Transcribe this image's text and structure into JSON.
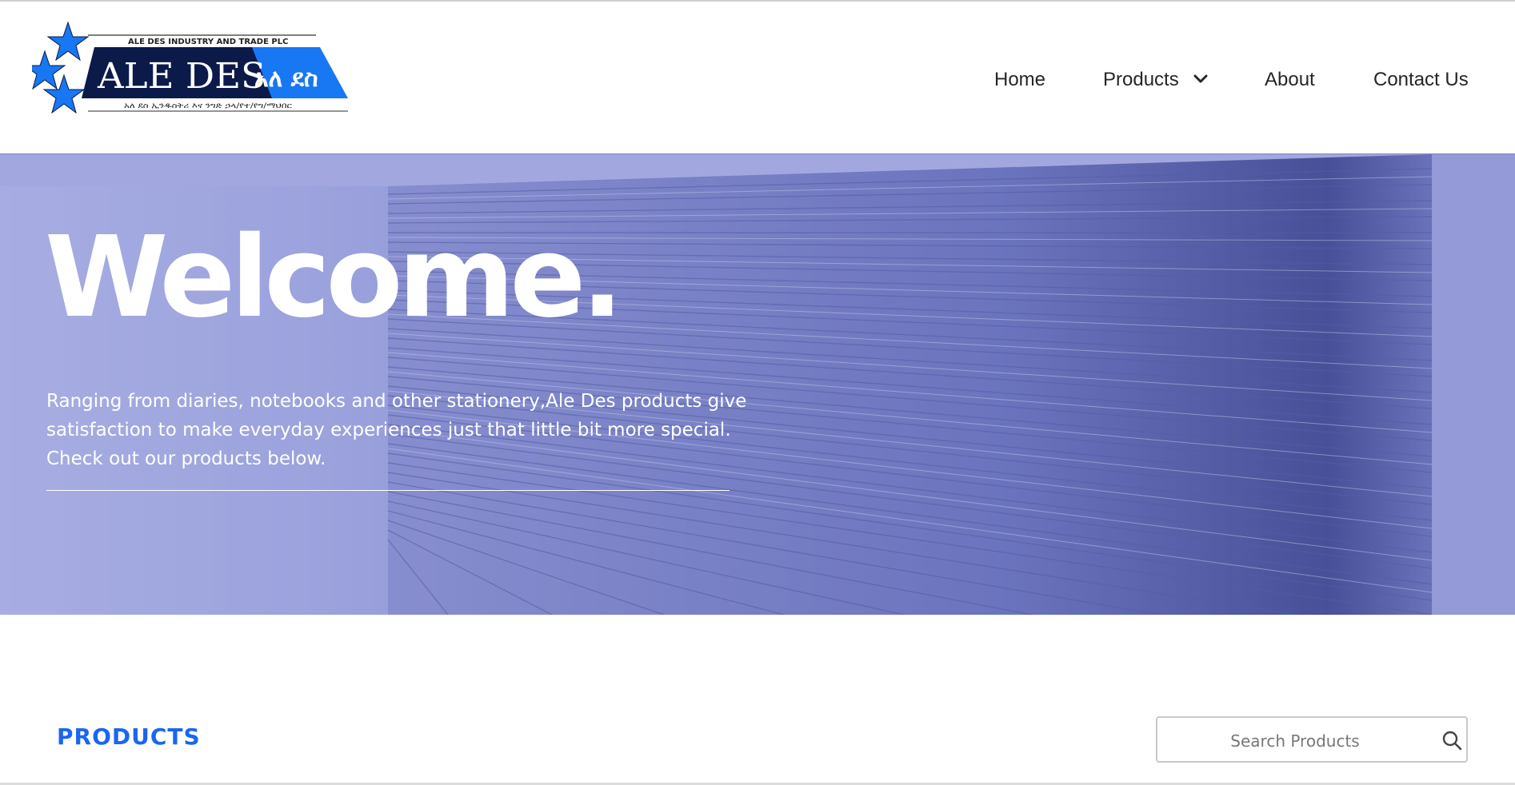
{
  "logo": {
    "company_line": "ALE DES INDUSTRY AND TRADE PLC",
    "brand_latin": "ALE DES",
    "brand_amharic": "አለ ደስ",
    "amharic_subline": "አለ ደስ ኢንዱስትሪ እና ንግድ ኃላ/የተ/የግ/ማህበር"
  },
  "nav": {
    "home": "Home",
    "products": "Products",
    "about": "About",
    "contact": "Contact Us"
  },
  "hero": {
    "title": "Welcome.",
    "text": "Ranging from diaries, notebooks and other stationery,Ale Des products give satisfaction to make everyday experiences just that little bit more special. Check out our products below."
  },
  "products": {
    "heading": "PRODUCTS",
    "search_placeholder": "Search Products"
  },
  "colors": {
    "accent": "#1a66f0",
    "logo_navy": "#0c1a4a",
    "logo_blue": "#1877f2",
    "hero_tint": "#7a82c6"
  }
}
